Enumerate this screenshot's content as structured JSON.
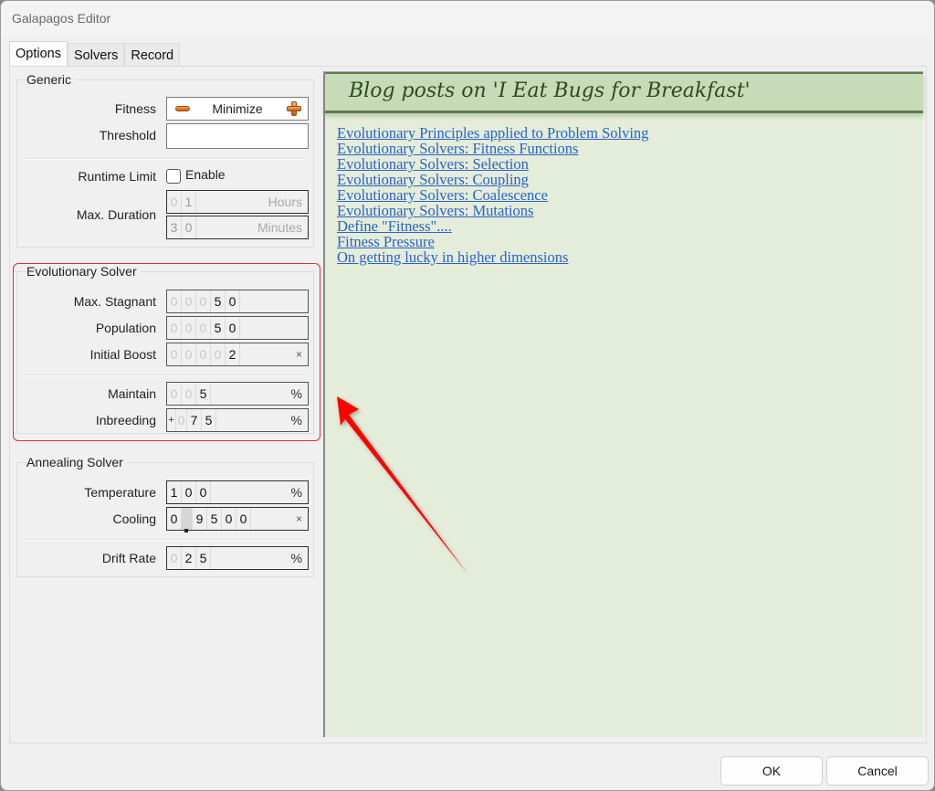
{
  "window": {
    "title": "Galapagos Editor"
  },
  "tabs": [
    {
      "label": "Options",
      "active": true
    },
    {
      "label": "Solvers",
      "active": false
    },
    {
      "label": "Record",
      "active": false
    }
  ],
  "generic": {
    "title": "Generic",
    "fitness": {
      "label": "Fitness",
      "value": "Minimize",
      "decrease_icon": "minus-icon",
      "increase_icon": "plus-icon"
    },
    "threshold": {
      "label": "Threshold",
      "value": ""
    },
    "runtime_limit": {
      "label": "Runtime Limit",
      "checkbox_label": "Enable",
      "checked": false
    },
    "max_duration": {
      "label": "Max. Duration",
      "hours": {
        "digits": [
          "0",
          "1"
        ],
        "unit": "Hours"
      },
      "minutes": {
        "digits": [
          "3",
          "0"
        ],
        "unit": "Minutes"
      }
    }
  },
  "evolutionary": {
    "title": "Evolutionary Solver",
    "max_stagnant": {
      "label": "Max. Stagnant",
      "digits": [
        "0",
        "0",
        "0",
        "5",
        "0"
      ],
      "value": "50"
    },
    "population": {
      "label": "Population",
      "digits": [
        "0",
        "0",
        "0",
        "5",
        "0"
      ],
      "value": "50"
    },
    "initial_boost": {
      "label": "Initial Boost",
      "digits": [
        "0",
        "0",
        "0",
        "0",
        "2"
      ],
      "value": "2",
      "unit": "×"
    },
    "maintain": {
      "label": "Maintain",
      "digits": [
        "0",
        "0",
        "5"
      ],
      "value": "5",
      "unit": "%"
    },
    "inbreeding": {
      "label": "Inbreeding",
      "sign": "+",
      "digits": [
        "0",
        "7",
        "5"
      ],
      "value": "+75",
      "unit": "%"
    }
  },
  "annealing": {
    "title": "Annealing Solver",
    "temperature": {
      "label": "Temperature",
      "digits": [
        "1",
        "0",
        "0"
      ],
      "value": "100",
      "unit": "%"
    },
    "cooling": {
      "label": "Cooling",
      "digits": [
        "0",
        ".",
        "9",
        "5",
        "0",
        "0"
      ],
      "value": "0.9500",
      "unit": "×"
    },
    "drift_rate": {
      "label": "Drift Rate",
      "digits": [
        "0",
        "2",
        "5"
      ],
      "value": "25",
      "unit": "%"
    }
  },
  "blog": {
    "header": "Blog posts on 'I Eat Bugs for Breakfast'",
    "links": [
      "Evolutionary Principles applied to Problem Solving",
      "Evolutionary Solvers: Fitness Functions",
      "Evolutionary Solvers: Selection",
      "Evolutionary Solvers: Coupling",
      "Evolutionary Solvers: Coalescence",
      "Evolutionary Solvers: Mutations",
      "Define \"Fitness\"....",
      "Fitness Pressure",
      "On getting lucky in higher dimensions"
    ]
  },
  "annotation": {
    "arrow_color": "#ff0000",
    "highlight_color": "#e03030"
  },
  "footer": {
    "ok_label": "OK",
    "cancel_label": "Cancel"
  }
}
